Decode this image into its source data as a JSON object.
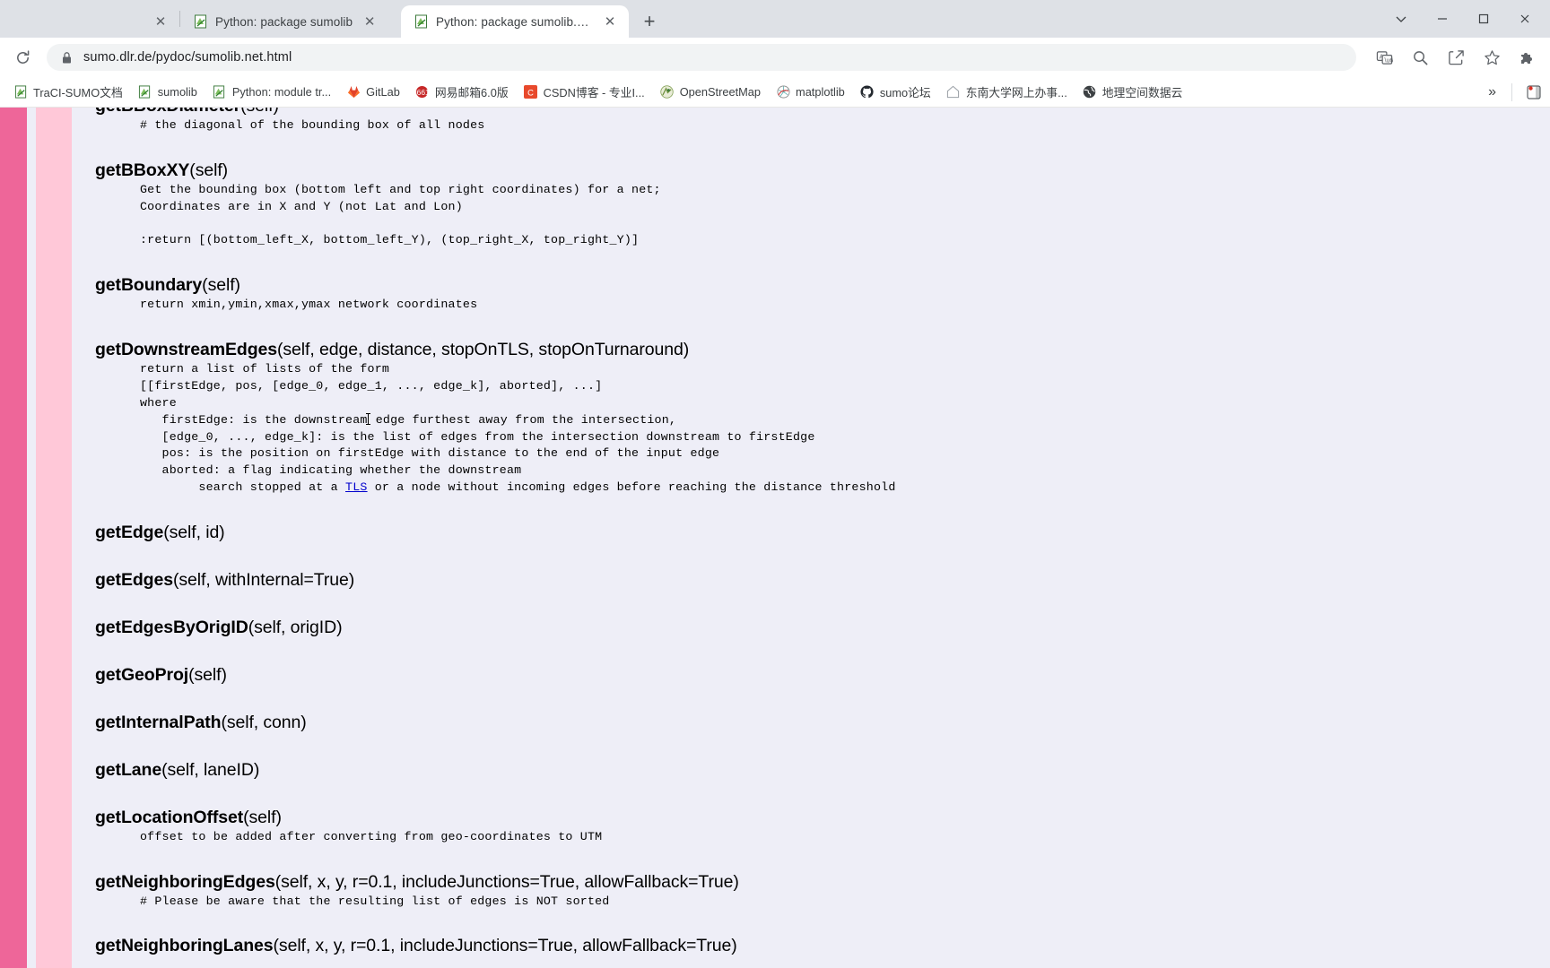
{
  "window": {
    "minimize_label": "—",
    "maximize_label": "□",
    "close_label": "✕",
    "menu_label": "∨"
  },
  "tabs": {
    "partial": {
      "title": "",
      "close_label": "✕"
    },
    "items": [
      {
        "title": "Python: package sumolib",
        "close_label": "✕",
        "active": false,
        "icon": "python-script-icon"
      },
      {
        "title": "Python: package sumolib.net",
        "close_label": "✕",
        "active": true,
        "icon": "python-script-icon"
      }
    ],
    "new_tab_label": "+"
  },
  "toolbar": {
    "reload_icon": "reload-icon",
    "lock_icon": "lock-icon",
    "url": "sumo.dlr.de/pydoc/sumolib.net.html",
    "translate_icon": "translate-icon",
    "zoom_icon": "zoom-search-icon",
    "share_icon": "share-icon",
    "bookmark_icon": "star-icon",
    "extensions_icon": "puzzle-icon"
  },
  "bookmarks": {
    "items": [
      {
        "label": "TraCI-SUMO文档",
        "icon": "python-script-icon"
      },
      {
        "label": "sumolib",
        "icon": "python-script-icon"
      },
      {
        "label": "Python: module tr...",
        "icon": "python-script-icon"
      },
      {
        "label": "GitLab",
        "icon": "gitlab-icon"
      },
      {
        "label": "网易邮箱6.0版",
        "icon": "netease-mail-icon"
      },
      {
        "label": "CSDN博客 - 专业I...",
        "icon": "csdn-icon"
      },
      {
        "label": "OpenStreetMap",
        "icon": "openstreetmap-icon"
      },
      {
        "label": "matplotlib",
        "icon": "matplotlib-icon"
      },
      {
        "label": "sumo论坛",
        "icon": "github-icon"
      },
      {
        "label": "东南大学网上办事...",
        "icon": "home-icon"
      },
      {
        "label": "地理空间数据云",
        "icon": "globe-icon"
      }
    ],
    "overflow_label": "»"
  },
  "colors": {
    "sidebar_accent": "#ee6699",
    "sidebar_light": "#ffc8d8",
    "content_bg": "#eeeef7",
    "link": "#0000cc",
    "tab_strip": "#dee1e6"
  },
  "doc": {
    "entries": [
      {
        "id": "getBBoxDiameter",
        "name": "getBBoxDiameter",
        "sig": "(self)",
        "clipped": true,
        "body": "# the diagonal of the bounding box of all nodes"
      },
      {
        "id": "getBBoxXY",
        "name": "getBBoxXY",
        "sig": "(self)",
        "body": "Get the bounding box (bottom left and top right coordinates) for a net;\nCoordinates are in X and Y (not Lat and Lon)\n\n:return [(bottom_left_X, bottom_left_Y), (top_right_X, top_right_Y)]"
      },
      {
        "id": "getBoundary",
        "name": "getBoundary",
        "sig": "(self)",
        "body": "return xmin,ymin,xmax,ymax network coordinates"
      },
      {
        "id": "getDownstreamEdges",
        "name": "getDownstreamEdges",
        "sig": "(self, edge, distance, stopOnTLS, stopOnTurnaround)",
        "body_lines": [
          "return a list of lists of the form",
          "[[firstEdge, pos, [edge_0, edge_1, ..., edge_k], aborted], ...]",
          "where",
          "   firstEdge: is the downstream edge furthest away from the intersection,",
          "   [edge_0, ..., edge_k]: is the list of edges from the intersection downstream to firstEdge",
          "   pos: is the position on firstEdge with distance to the end of the input edge",
          "   aborted: a flag indicating whether the downstream"
        ],
        "tls_line_prefix": "        search stopped at a ",
        "tls_link": "TLS",
        "tls_line_suffix": " or a node without incoming edges before reaching the distance threshold",
        "caret_after": "downstream"
      },
      {
        "id": "getEdge",
        "name": "getEdge",
        "sig": "(self, id)",
        "body": ""
      },
      {
        "id": "getEdges",
        "name": "getEdges",
        "sig": "(self, withInternal=True)",
        "body": ""
      },
      {
        "id": "getEdgesByOrigID",
        "name": "getEdgesByOrigID",
        "sig": "(self, origID)",
        "body": ""
      },
      {
        "id": "getGeoProj",
        "name": "getGeoProj",
        "sig": "(self)",
        "body": ""
      },
      {
        "id": "getInternalPath",
        "name": "getInternalPath",
        "sig": "(self, conn)",
        "body": ""
      },
      {
        "id": "getLane",
        "name": "getLane",
        "sig": "(self, laneID)",
        "body": ""
      },
      {
        "id": "getLocationOffset",
        "name": "getLocationOffset",
        "sig": "(self)",
        "body": "offset to be added after converting from geo-coordinates to UTM"
      },
      {
        "id": "getNeighboringEdges",
        "name": "getNeighboringEdges",
        "sig": "(self, x, y, r=0.1, includeJunctions=True, allowFallback=True)",
        "body": "# Please be aware that the resulting list of edges is NOT sorted"
      },
      {
        "id": "getNeighboringLanes",
        "name": "getNeighboringLanes",
        "sig": "(self, x, y, r=0.1, includeJunctions=True, allowFallback=True)",
        "body": "",
        "cut_off": true
      }
    ]
  }
}
